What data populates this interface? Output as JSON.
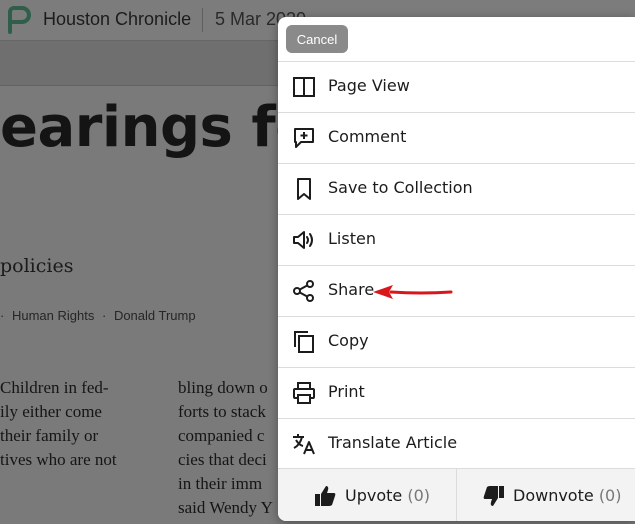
{
  "header": {
    "publication": "Houston Chronicle",
    "date": "5 Mar 2020"
  },
  "article": {
    "headline_fragment": "earings for",
    "subhead_fragment": "policies",
    "tags": [
      "·",
      "Human Rights",
      "·",
      "Donald Trump"
    ],
    "column1": [
      "Children in fed-",
      "ily either come",
      "their family or",
      "tives who are not"
    ],
    "column2": [
      "bling down o",
      "forts to stack",
      "companied c",
      "cies that deci",
      "in their imm",
      "said Wendy Y"
    ]
  },
  "sheet": {
    "cancel_label": "Cancel",
    "items": [
      {
        "label": "Page View",
        "icon": "page-view-icon"
      },
      {
        "label": "Comment",
        "icon": "comment-icon"
      },
      {
        "label": "Save to Collection",
        "icon": "bookmark-icon"
      },
      {
        "label": "Listen",
        "icon": "speaker-icon"
      },
      {
        "label": "Share",
        "icon": "share-icon"
      },
      {
        "label": "Copy",
        "icon": "copy-icon"
      },
      {
        "label": "Print",
        "icon": "printer-icon"
      },
      {
        "label": "Translate Article",
        "icon": "translate-icon"
      }
    ],
    "upvote": {
      "label": "Upvote",
      "count": "(0)"
    },
    "downvote": {
      "label": "Downvote",
      "count": "(0)"
    }
  },
  "colors": {
    "brand": "#3f8f6f",
    "annotation_arrow": "#d9161a",
    "overlay_background": "#7a7a7a",
    "cancel_button": "#8a8a8a"
  }
}
